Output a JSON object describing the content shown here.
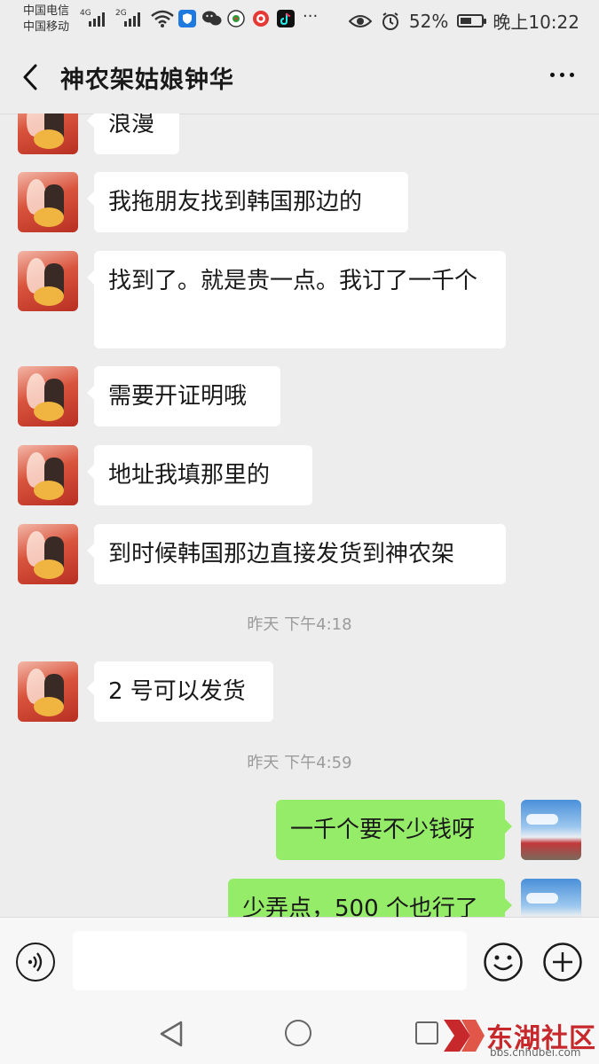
{
  "statusbar": {
    "carrier1": "中国电信",
    "carrier2": "中国移动",
    "net1": "4G",
    "net2": "2G",
    "more": "···",
    "battery": "52%",
    "battery_level": 0.52,
    "time": "晚上10:22",
    "apps": [
      "shield-app",
      "wechat-app",
      "camera-app",
      "weibo-app",
      "tiktok-app"
    ]
  },
  "header": {
    "title": "神农架姑娘钟华"
  },
  "messages": [
    {
      "side": "in",
      "text": "浪漫"
    },
    {
      "side": "in",
      "text": "我拖朋友找到韩国那边的"
    },
    {
      "side": "in",
      "text": "找到了。就是贵一点。我订了一千个"
    },
    {
      "side": "in",
      "text": "需要开证明哦"
    },
    {
      "side": "in",
      "text": "地址我填那里的"
    },
    {
      "side": "in",
      "text": "到时候韩国那边直接发货到神农架"
    },
    {
      "type": "time",
      "text": "昨天  下午4:18"
    },
    {
      "side": "in",
      "text": "2 号可以发货"
    },
    {
      "type": "time",
      "text": "昨天  下午4:59"
    },
    {
      "side": "out",
      "text": "一千个要不少钱呀"
    },
    {
      "side": "out",
      "text": "少弄点，500 个也行了"
    }
  ],
  "input": {
    "placeholder": ""
  },
  "watermark": {
    "name": "东湖社区",
    "url": "bbs.cnhubei.com"
  },
  "colors": {
    "background": "#ededed",
    "incoming_bubble": "#ffffff",
    "outgoing_bubble": "#95ec69",
    "watermark": "#c6282b"
  }
}
